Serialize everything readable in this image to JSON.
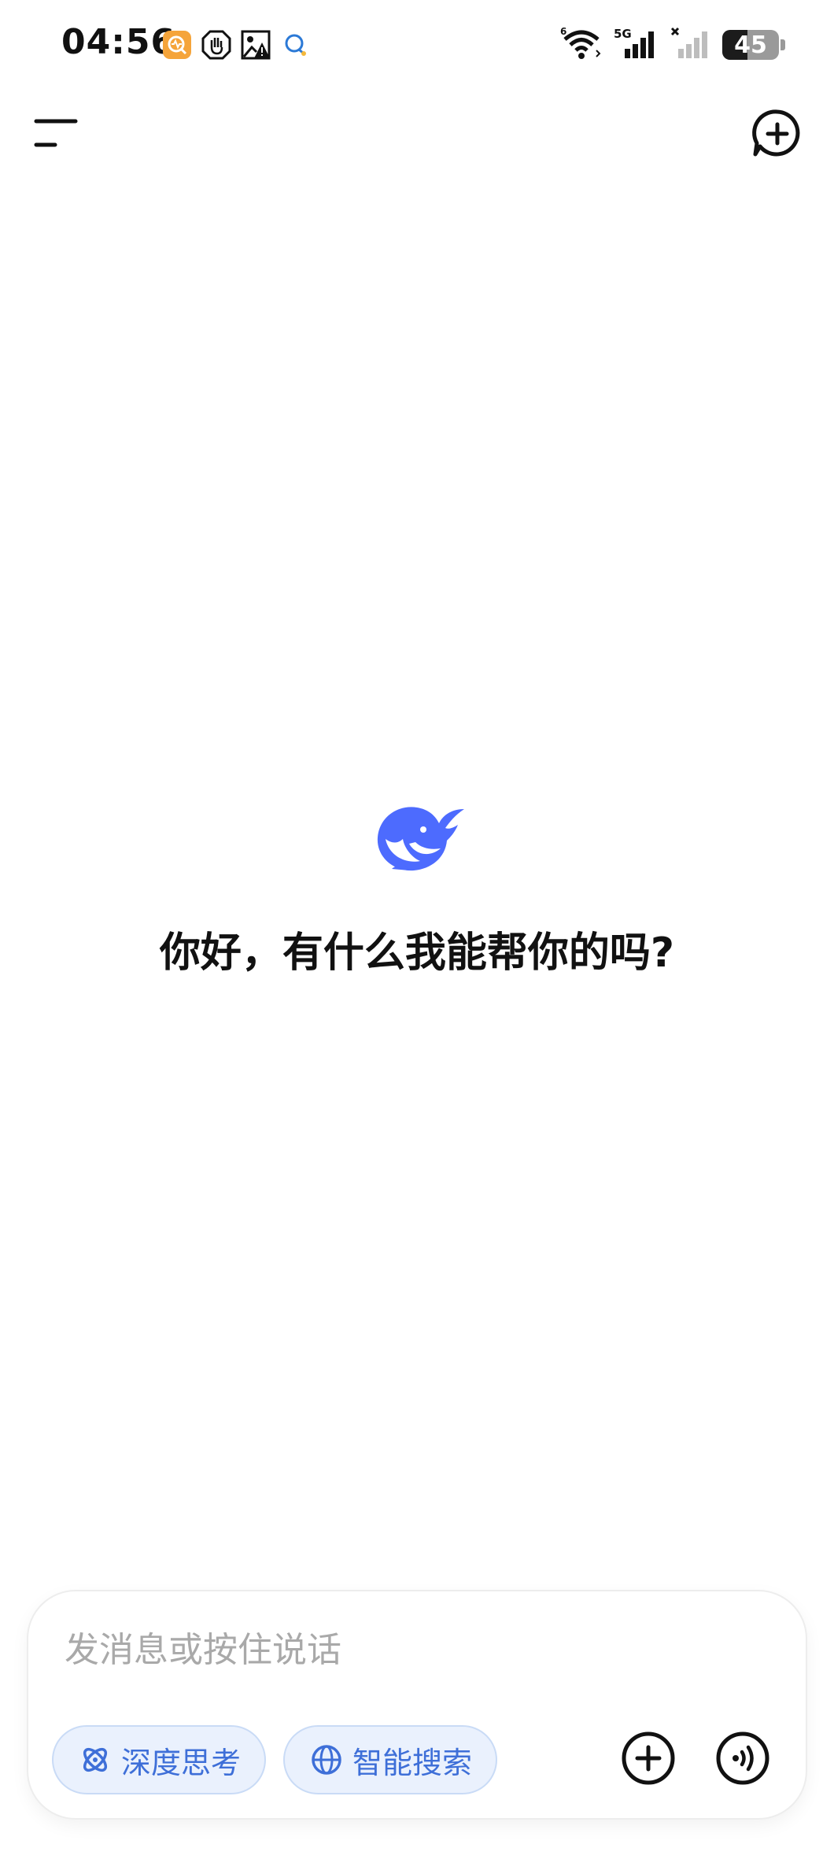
{
  "status_bar": {
    "time": "04:56",
    "battery_level": "45",
    "battery_fraction": 0.45,
    "network_label": "5G",
    "icons": [
      "health-app-icon",
      "hand-block-icon",
      "image-alert-icon",
      "chat-bubble-icon",
      "wifi-icon",
      "signal-5g-icon",
      "signal-no-sim-icon",
      "battery-icon"
    ]
  },
  "nav": {
    "menu_icon": "menu-icon",
    "new_chat_icon": "new-chat-icon"
  },
  "main": {
    "logo": "deepseek-whale-logo",
    "greeting": "你好，有什么我能帮你的吗?"
  },
  "composer": {
    "placeholder": "发消息或按住说话",
    "chips": [
      {
        "label": "深度思考",
        "icon": "atom-icon"
      },
      {
        "label": "智能搜索",
        "icon": "globe-icon"
      }
    ],
    "attach_icon": "plus-circle-icon",
    "voice_icon": "voice-wave-icon"
  },
  "colors": {
    "accent": "#4d6bfe",
    "chip_bg": "#eaf1fd",
    "chip_text": "#3e6fd8",
    "placeholder": "#a9a9a9"
  }
}
